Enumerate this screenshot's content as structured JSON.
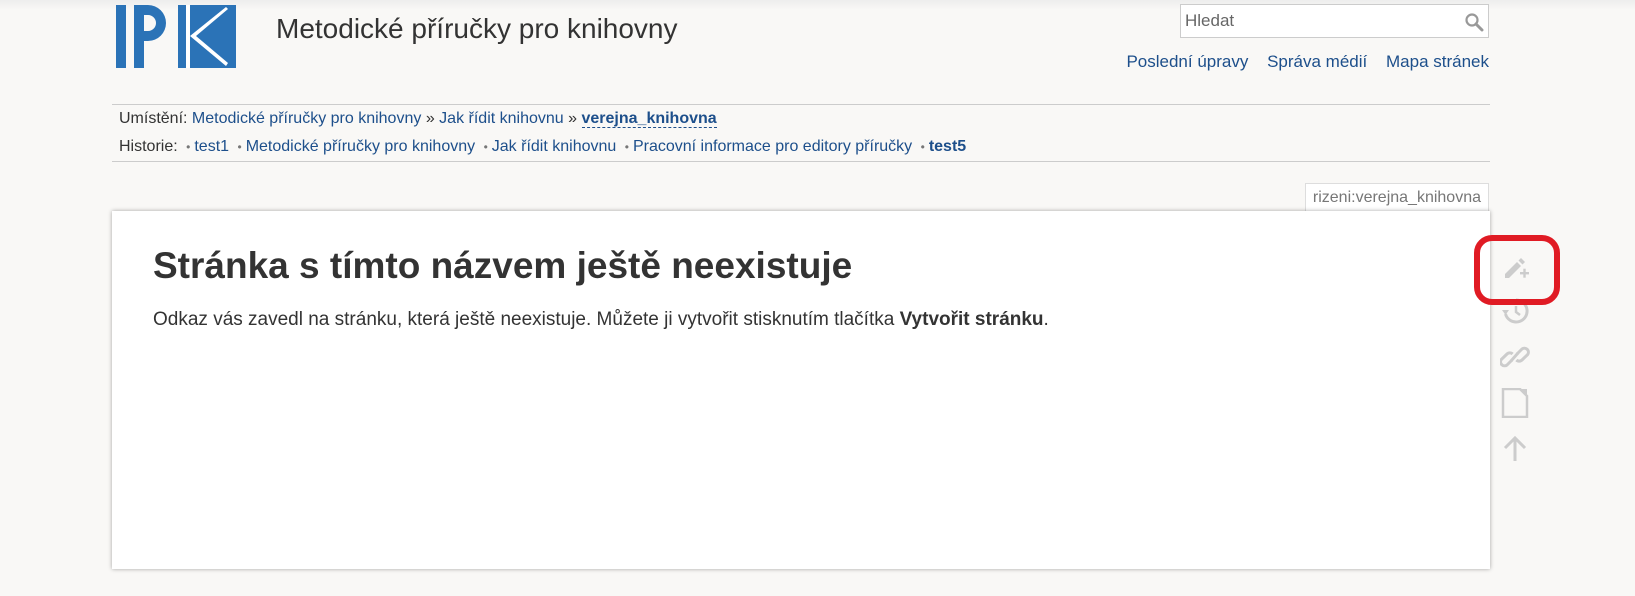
{
  "header": {
    "logo_text": "IPK",
    "site_title": "Metodické příručky pro knihovny",
    "search_placeholder": "Hledat"
  },
  "usertools": [
    "Poslední úpravy",
    "Správa médií",
    "Mapa stránek"
  ],
  "breadcrumbs": {
    "label": "Umístění:",
    "items": [
      "Metodické příručky pro knihovny",
      "Jak řídit knihovnu"
    ],
    "separator": "»",
    "current": "verejna_knihovna"
  },
  "history": {
    "label": "Historie:",
    "items": [
      "test1",
      "Metodické příručky pro knihovny",
      "Jak řídit knihovnu",
      "Pracovní informace pro editory příručky"
    ],
    "current": "test5"
  },
  "page": {
    "id": "rizeni:verejna_knihovna",
    "heading": "Stránka s tímto názvem ještě neexistuje",
    "text_before": "Odkaz vás zavedl na stránku, která ještě neexistuje. Můžete ji vytvořit stisknutím tlačítka ",
    "text_strong": "Vytvořit stránku",
    "text_after": "."
  },
  "colors": {
    "link": "#1d4f8b",
    "logo_blue": "#2b73b7",
    "highlight": "#e01b24",
    "tool_icon": "#cccccc"
  },
  "page_tools": [
    "create-page-icon",
    "old-revisions-icon",
    "backlinks-icon",
    "media-file-icon",
    "back-to-top-icon"
  ]
}
